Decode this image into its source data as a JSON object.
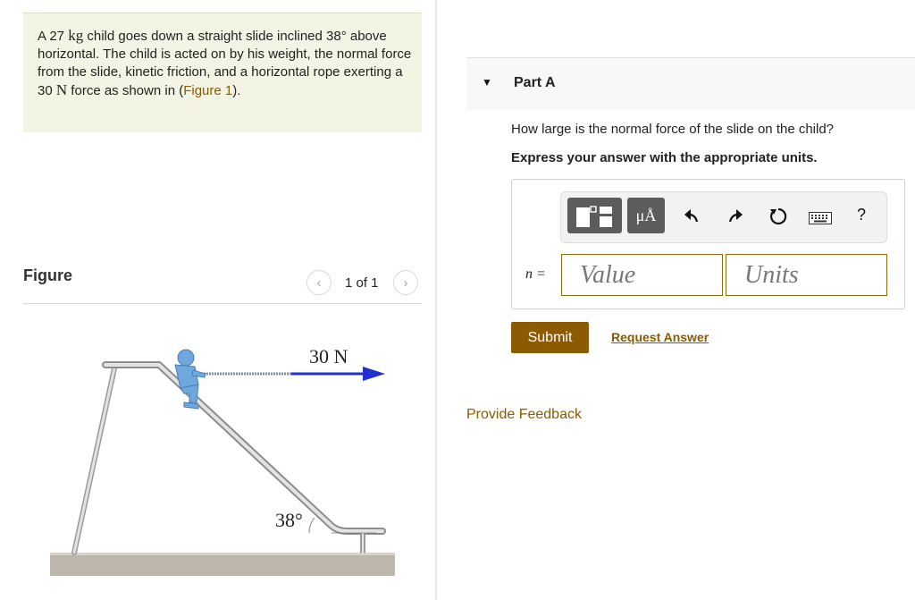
{
  "problem": {
    "text_1": "A 27 ",
    "unit_mass": "kg",
    "text_2": " child goes down a straight slide inclined 38° above horizontal. The child is acted on by his weight, the normal force from the slide, kinetic friction, and a horizontal rope exerting a 30 ",
    "unit_force": "N",
    "text_3": " force as shown in (",
    "figure_link": "Figure 1",
    "text_4": ")."
  },
  "figure": {
    "label": "Figure",
    "pager": {
      "prev_icon": "‹",
      "count": "1 of 1",
      "next_icon": "›"
    },
    "force_label": "30 N",
    "angle_label": "38°"
  },
  "part_a": {
    "caret": "▼",
    "title": "Part A",
    "question": "How large is the normal force of the slide on the child?",
    "instruction": "Express your answer with the appropriate units.",
    "toolbar": {
      "templates_icon": "templates-icon",
      "units_label": "μÅ",
      "undo_icon": "undo-icon",
      "redo_icon": "redo-icon",
      "reset_icon": "reset-icon",
      "keyboard_icon": "keyboard-icon",
      "help_label": "?"
    },
    "variable_label": "n =",
    "value_placeholder": "Value",
    "units_placeholder": "Units",
    "submit_label": "Submit",
    "request_answer_label": "Request Answer"
  },
  "feedback_label": "Provide Feedback",
  "colors": {
    "accent": "#8c5a00",
    "link": "#8a5a00",
    "problem_bg": "#f4f4e4",
    "child": "#6fa8dc",
    "arrow": "#1f2fd0"
  }
}
